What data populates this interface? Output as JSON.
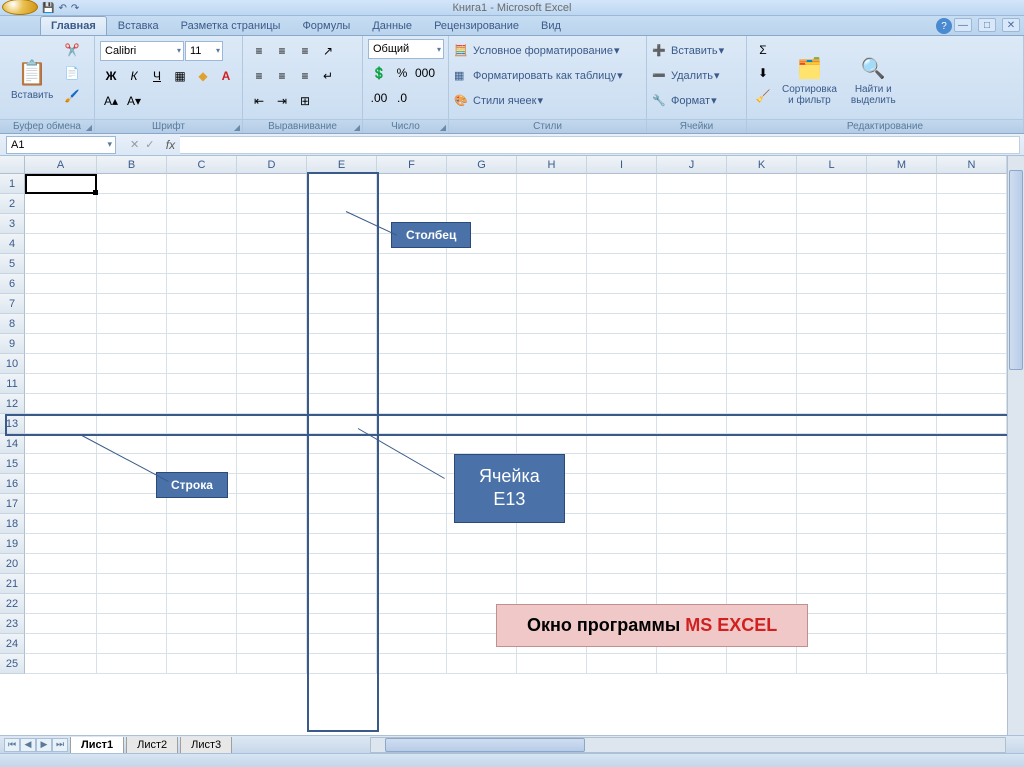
{
  "title": "Книга1 - Microsoft Excel",
  "tabs": [
    "Главная",
    "Вставка",
    "Разметка страницы",
    "Формулы",
    "Данные",
    "Рецензирование",
    "Вид"
  ],
  "ribbon": {
    "clipboard": {
      "label": "Буфер обмена",
      "paste": "Вставить"
    },
    "font": {
      "label": "Шрифт",
      "name": "Calibri",
      "size": "11"
    },
    "alignment": {
      "label": "Выравнивание"
    },
    "number": {
      "label": "Число",
      "format": "Общий"
    },
    "styles": {
      "label": "Стили",
      "conditional": "Условное форматирование",
      "as_table": "Форматировать как таблицу",
      "cell_styles": "Стили ячеек"
    },
    "cells": {
      "label": "Ячейки",
      "insert": "Вставить",
      "delete": "Удалить",
      "format": "Формат"
    },
    "editing": {
      "label": "Редактирование",
      "sort": "Сортировка\nи фильтр",
      "find": "Найти и\nвыделить"
    }
  },
  "namebox": "A1",
  "columns": [
    "A",
    "B",
    "C",
    "D",
    "E",
    "F",
    "G",
    "H",
    "I",
    "J",
    "K",
    "L",
    "M",
    "N"
  ],
  "rows": [
    "1",
    "2",
    "3",
    "4",
    "5",
    "6",
    "7",
    "8",
    "9",
    "10",
    "11",
    "12",
    "13",
    "14",
    "15",
    "16",
    "17",
    "18",
    "19",
    "20",
    "21",
    "22",
    "23",
    "24",
    "25"
  ],
  "sheets": [
    "Лист1",
    "Лист2",
    "Лист3"
  ],
  "annotations": {
    "column": "Столбец",
    "row": "Строка",
    "cell": "Ячейка\nЕ13",
    "title_black": "Окно программы ",
    "title_red": "MS EXCEL"
  }
}
